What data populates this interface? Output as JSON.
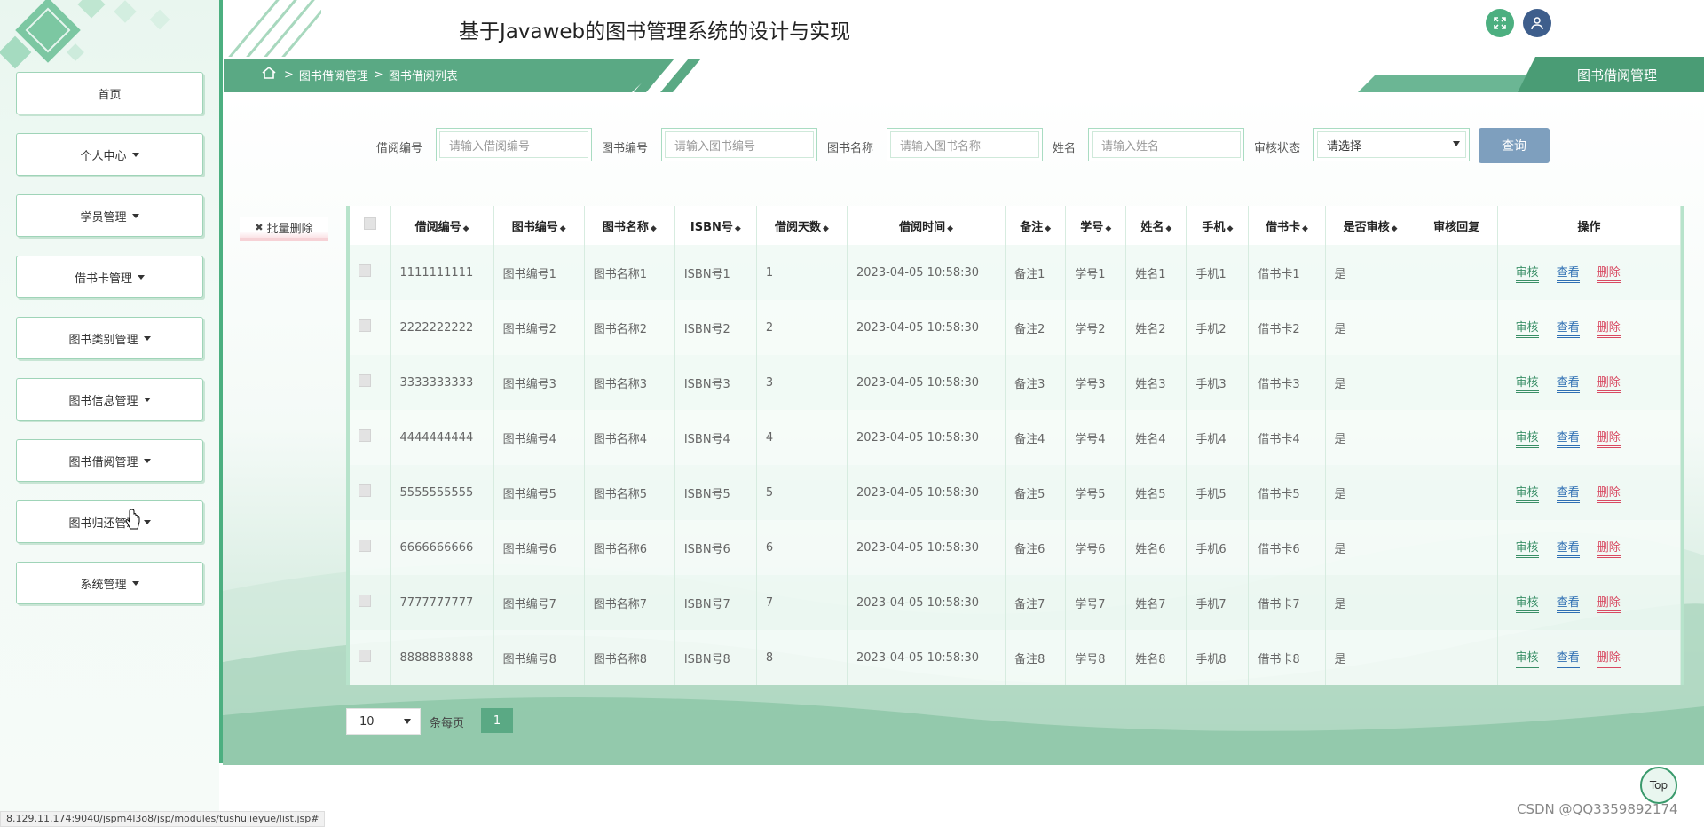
{
  "app": {
    "title": "基于Javaweb的图书管理系统的设计与实现"
  },
  "sidebar": {
    "items": [
      {
        "label": "首页",
        "dropdown": false
      },
      {
        "label": "个人中心",
        "dropdown": true
      },
      {
        "label": "学员管理",
        "dropdown": true
      },
      {
        "label": "借书卡管理",
        "dropdown": true
      },
      {
        "label": "图书类别管理",
        "dropdown": true
      },
      {
        "label": "图书信息管理",
        "dropdown": true
      },
      {
        "label": "图书借阅管理",
        "dropdown": true
      },
      {
        "label": "图书归还管理",
        "dropdown": true
      },
      {
        "label": "系统管理",
        "dropdown": true
      }
    ]
  },
  "header": {
    "icons": [
      "fullscreen-icon",
      "user-icon"
    ],
    "colors": {
      "fullscreen": "#4caf80",
      "user": "#3e5e8c"
    }
  },
  "breadcrumb": {
    "sep1": ">",
    "level1": "图书借阅管理",
    "sep2": ">",
    "level2": "图书借阅列表"
  },
  "page_tab": "图书借阅管理",
  "search": {
    "fields": [
      {
        "label": "借阅编号",
        "placeholder": "请输入借阅编号"
      },
      {
        "label": "图书编号",
        "placeholder": "请输入图书编号"
      },
      {
        "label": "图书名称",
        "placeholder": "请输入图书名称"
      },
      {
        "label": "姓名",
        "placeholder": "请输入姓名"
      }
    ],
    "status_label": "审核状态",
    "status_value": "请选择",
    "query_button": "查询"
  },
  "batch_delete": {
    "icon": "✖",
    "label": "批量删除"
  },
  "table": {
    "sort_glyph": "◆",
    "columns": [
      "借阅编号",
      "图书编号",
      "图书名称",
      "ISBN号",
      "借阅天数",
      "借阅时间",
      "备注",
      "学号",
      "姓名",
      "手机",
      "借书卡",
      "是否审核",
      "审核回复",
      "操作"
    ],
    "sortable": [
      true,
      true,
      true,
      true,
      true,
      true,
      true,
      true,
      true,
      true,
      true,
      true,
      false,
      false
    ],
    "actions": {
      "audit": "审核",
      "view": "查看",
      "delete": "删除"
    },
    "rows": [
      [
        "1111111111",
        "图书编号1",
        "图书名称1",
        "ISBN号1",
        "1",
        "2023-04-05 10:58:30",
        "备注1",
        "学号1",
        "姓名1",
        "手机1",
        "借书卡1",
        "是",
        ""
      ],
      [
        "2222222222",
        "图书编号2",
        "图书名称2",
        "ISBN号2",
        "2",
        "2023-04-05 10:58:30",
        "备注2",
        "学号2",
        "姓名2",
        "手机2",
        "借书卡2",
        "是",
        ""
      ],
      [
        "3333333333",
        "图书编号3",
        "图书名称3",
        "ISBN号3",
        "3",
        "2023-04-05 10:58:30",
        "备注3",
        "学号3",
        "姓名3",
        "手机3",
        "借书卡3",
        "是",
        ""
      ],
      [
        "4444444444",
        "图书编号4",
        "图书名称4",
        "ISBN号4",
        "4",
        "2023-04-05 10:58:30",
        "备注4",
        "学号4",
        "姓名4",
        "手机4",
        "借书卡4",
        "是",
        ""
      ],
      [
        "5555555555",
        "图书编号5",
        "图书名称5",
        "ISBN号5",
        "5",
        "2023-04-05 10:58:30",
        "备注5",
        "学号5",
        "姓名5",
        "手机5",
        "借书卡5",
        "是",
        ""
      ],
      [
        "6666666666",
        "图书编号6",
        "图书名称6",
        "ISBN号6",
        "6",
        "2023-04-05 10:58:30",
        "备注6",
        "学号6",
        "姓名6",
        "手机6",
        "借书卡6",
        "是",
        ""
      ],
      [
        "7777777777",
        "图书编号7",
        "图书名称7",
        "ISBN号7",
        "7",
        "2023-04-05 10:58:30",
        "备注7",
        "学号7",
        "姓名7",
        "手机7",
        "借书卡7",
        "是",
        ""
      ],
      [
        "8888888888",
        "图书编号8",
        "图书名称8",
        "ISBN号8",
        "8",
        "2023-04-05 10:58:30",
        "备注8",
        "学号8",
        "姓名8",
        "手机8",
        "借书卡8",
        "是",
        ""
      ]
    ]
  },
  "pager": {
    "page_size": "10",
    "per_page_label": "条每页",
    "current_page": "1"
  },
  "top_button": "Top",
  "status_bar_url": "8.129.11.174:9040/jspm4l3o8/jsp/modules/tushujieyue/list.jsp#",
  "watermark": "CSDN @QQ3359892174",
  "colors": {
    "accent": "#5aa984",
    "query_btn": "#7e9fbe",
    "delete": "#d84a62",
    "view": "#2f6fb3",
    "audit": "#3a8f67"
  }
}
